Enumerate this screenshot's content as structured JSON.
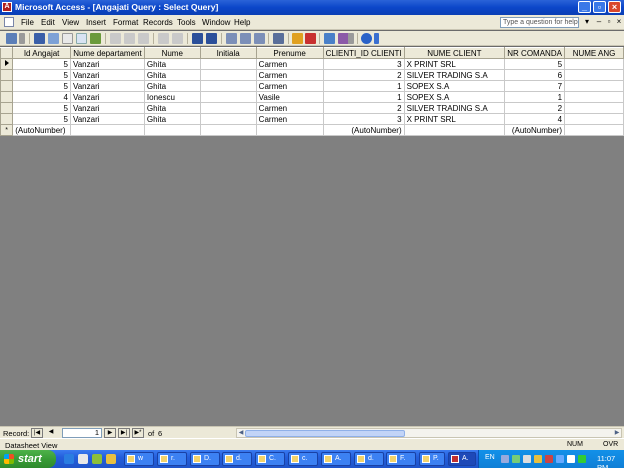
{
  "window": {
    "title": "Microsoft Access - [Angajati Query : Select Query]",
    "app_icon": "access-key-icon"
  },
  "menu": {
    "items": [
      "File",
      "Edit",
      "View",
      "Insert",
      "Format",
      "Records",
      "Tools",
      "Window",
      "Help"
    ],
    "help_placeholder": "Type a question for help"
  },
  "table": {
    "columns": [
      "Id Angajat",
      "Nume departament",
      "Nume",
      "Initiala",
      "Prenume",
      "CLIENTI_ID CLIENTI",
      "NUME CLIENT",
      "NR COMANDA",
      "NUME ANG"
    ],
    "rows": [
      {
        "id": "5",
        "dept": "Vanzari",
        "nume": "Ghita",
        "initiala": "",
        "prenume": "Carmen",
        "client_id": "3",
        "client": "X PRINT SRL",
        "comanda": "5"
      },
      {
        "id": "5",
        "dept": "Vanzari",
        "nume": "Ghita",
        "initiala": "",
        "prenume": "Carmen",
        "client_id": "2",
        "client": "SILVER TRADING S.A",
        "comanda": "6"
      },
      {
        "id": "5",
        "dept": "Vanzari",
        "nume": "Ghita",
        "initiala": "",
        "prenume": "Carmen",
        "client_id": "1",
        "client": "SOPEX S.A",
        "comanda": "7"
      },
      {
        "id": "4",
        "dept": "Vanzari",
        "nume": "Ionescu",
        "initiala": "",
        "prenume": "Vasile",
        "client_id": "1",
        "client": "SOPEX S.A",
        "comanda": "1"
      },
      {
        "id": "5",
        "dept": "Vanzari",
        "nume": "Ghita",
        "initiala": "",
        "prenume": "Carmen",
        "client_id": "2",
        "client": "SILVER TRADING S.A",
        "comanda": "2"
      },
      {
        "id": "5",
        "dept": "Vanzari",
        "nume": "Ghita",
        "initiala": "",
        "prenume": "Carmen",
        "client_id": "3",
        "client": "X PRINT SRL",
        "comanda": "4"
      }
    ],
    "new_row": {
      "id": "(AutoNumber)",
      "client_id": "(AutoNumber)",
      "comanda": "(AutoNumber)"
    },
    "new_row_marker": "*"
  },
  "navigation": {
    "label": "Record:",
    "current": "1",
    "of_label": "of",
    "total": "6"
  },
  "status": {
    "view": "Datasheet View",
    "num": "NUM",
    "ovr": "OVR"
  },
  "taskbar": {
    "start": "start",
    "tasks": [
      "w",
      "r.",
      "D.",
      "d.",
      "C.",
      "c.",
      "A.",
      "d.",
      "F.",
      "P.",
      "A."
    ],
    "lang": "EN",
    "clock": "11:07 PM"
  }
}
